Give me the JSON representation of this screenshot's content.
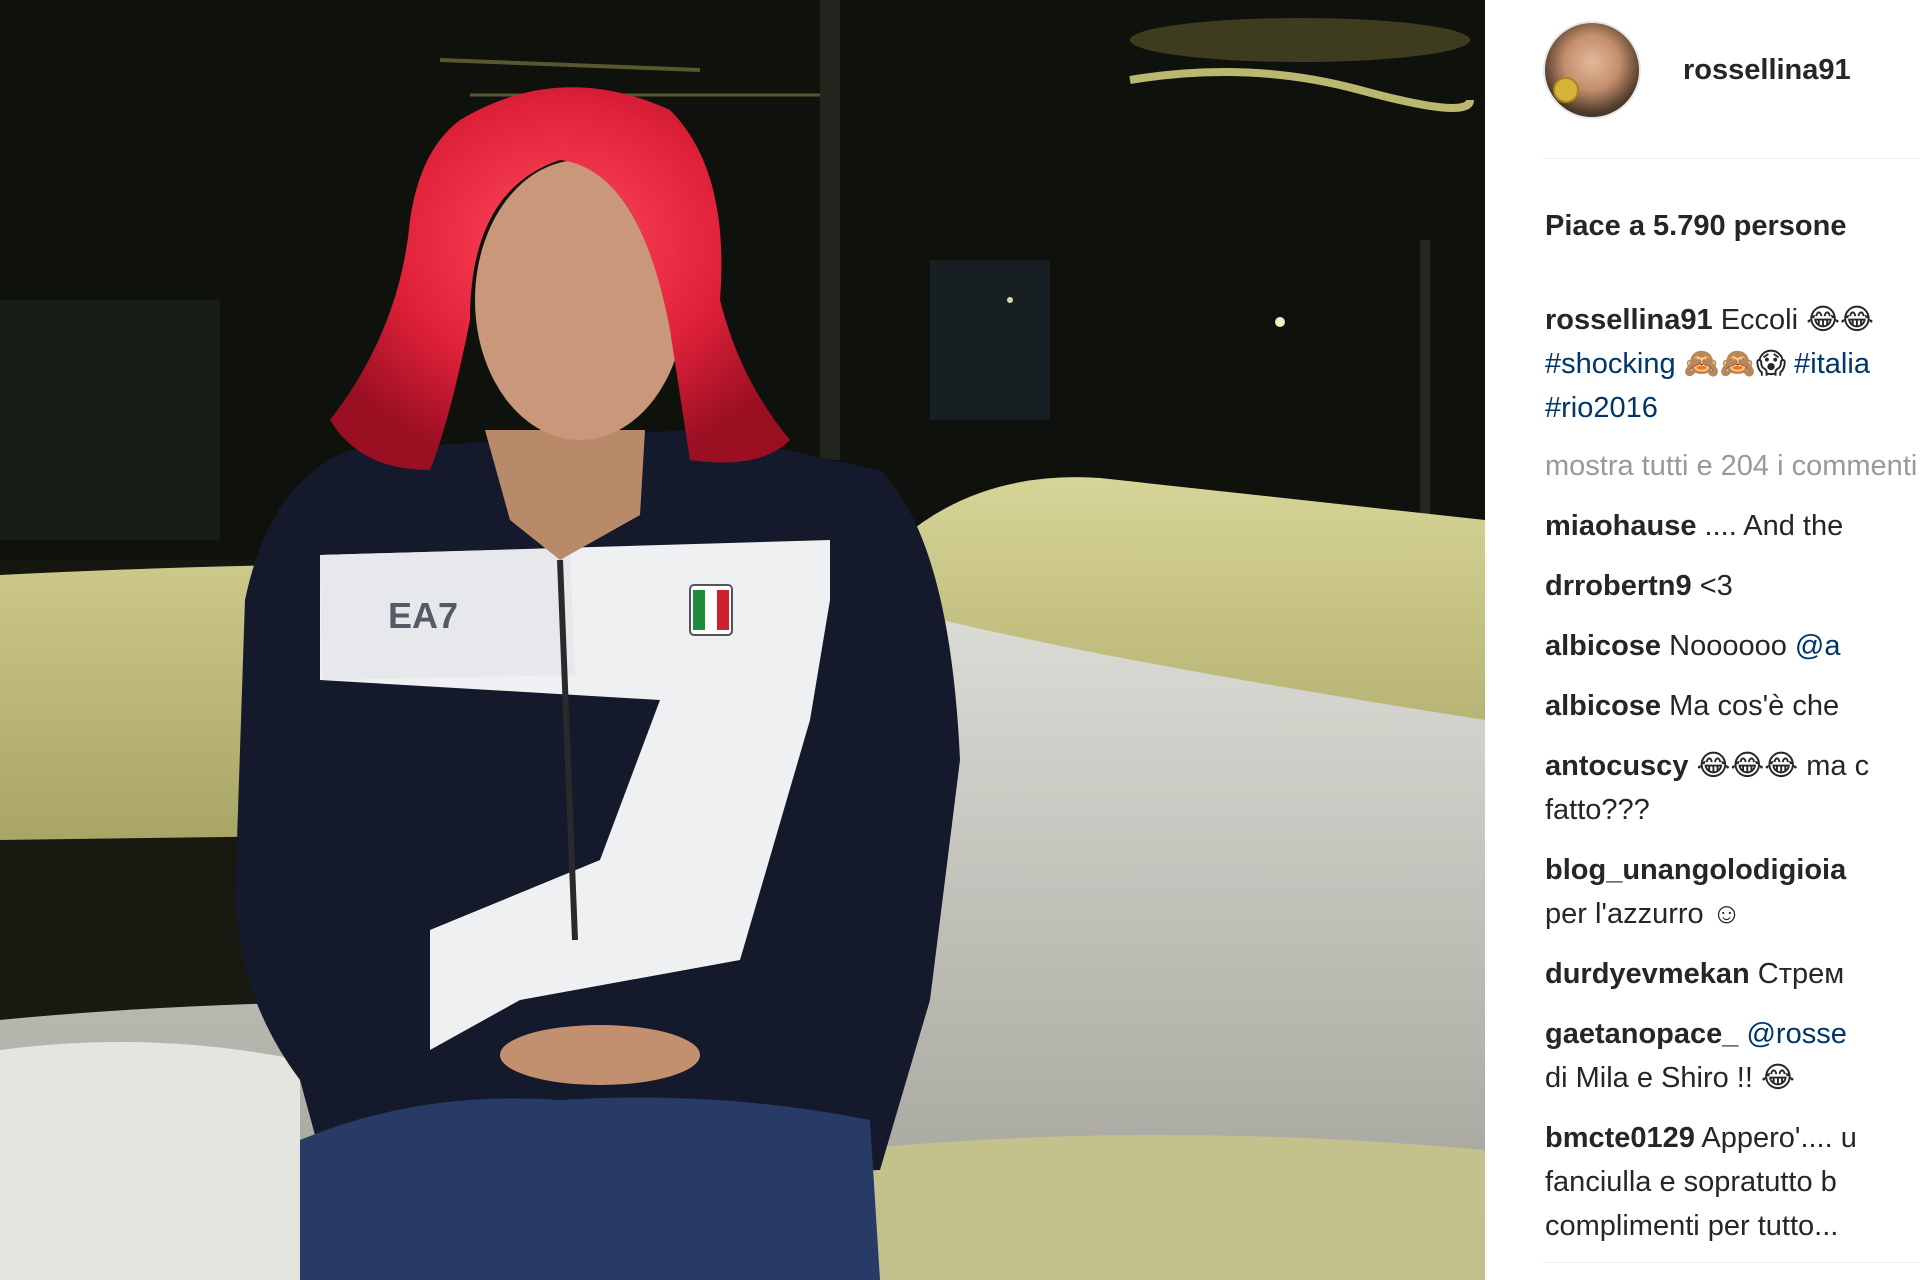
{
  "post": {
    "username": "rossellina91",
    "likes_text": "Piace a 5.790 persone",
    "caption": {
      "username": "rossellina91",
      "text": " Eccoli 😂😂",
      "line2_tag1": "#shocking",
      "line2_mid": " 🙈🙈😱 ",
      "line2_tag2": "#italia",
      "line3_tag": "#rio2016"
    },
    "view_all_comments": "mostra tutti e 204 i commenti",
    "comments": [
      {
        "user": "miaohause",
        "text": " .... And the",
        "lines": []
      },
      {
        "user": "drrobertn9",
        "text": " <3",
        "lines": []
      },
      {
        "user": "albicose",
        "text": " Noooooo ",
        "mention": "@a",
        "lines": []
      },
      {
        "user": "albicose",
        "text": " Ma cos'è che",
        "lines": []
      },
      {
        "user": "antocuscy",
        "text": " 😂😂😂 ma c",
        "lines": [
          "fatto???"
        ]
      },
      {
        "user": "blog_unangolodigioia",
        "text": "",
        "lines": [
          "per l'azzurro ☺"
        ]
      },
      {
        "user": "durdyevmekan",
        "text": "  Стрем",
        "lines": []
      },
      {
        "user": "gaetanopace_",
        "text": " ",
        "mention": "@rosse",
        "lines": [
          "di Mila e Shiro !! 😂"
        ]
      },
      {
        "user": "bmcte0129",
        "text": " Appero'.... u",
        "lines": [
          "fanciulla e sopratutto b",
          "complimenti per tutto..."
        ]
      }
    ]
  },
  "photo": {
    "jacket_logo": "EA7",
    "colors": {
      "hair": "#e0213a",
      "jacket": "#141a2b",
      "sofa": "#c9c789",
      "tag_link": "#003569"
    }
  }
}
